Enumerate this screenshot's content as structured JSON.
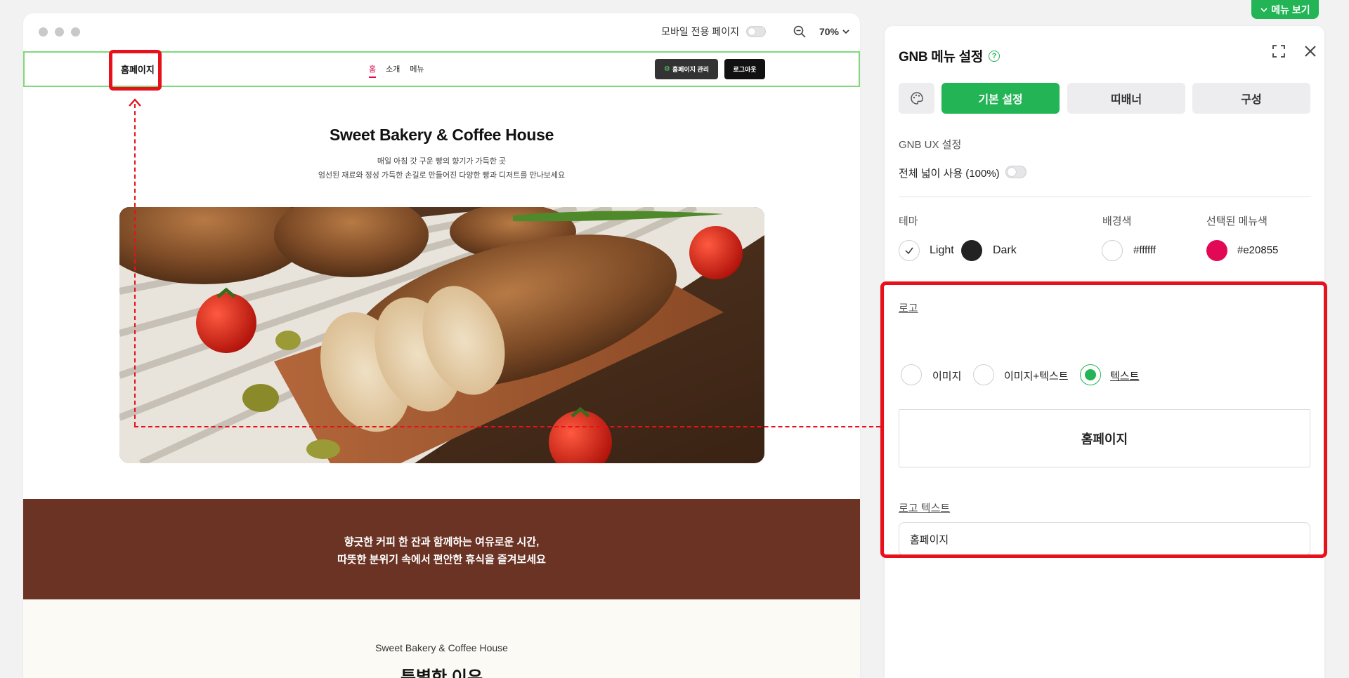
{
  "preview": {
    "mobile_label": "모바일 전용 페이지",
    "zoom": "70%",
    "gnb": {
      "logo": "홈페이지",
      "menu": [
        "홈",
        "소개",
        "메뉴"
      ],
      "manage_button": "홈페이지 관리",
      "logout_button": "로그아웃"
    },
    "hero": {
      "title": "Sweet Bakery & Coffee House",
      "sub1": "매일 아침 갓 구운 빵의 향기가 가득한 곳",
      "sub2": "엄선된 재료와 정성 가득한 손길로 만들어진 다양한 빵과 디저트를 만나보세요"
    },
    "band": {
      "line1": "향긋한 커피 한 잔과 함께하는 여유로운 시간,",
      "line2": "따뜻한 분위기 속에서 편안한 휴식을 즐겨보세요"
    },
    "section": {
      "small": "Sweet Bakery & Coffee House",
      "big": "특별한 이유"
    }
  },
  "panel": {
    "menu_view_button": "메뉴 보기",
    "title": "GNB 메뉴 설정",
    "tabs": {
      "basic": "기본 설정",
      "banner": "띠배너",
      "compose": "구성"
    },
    "gnb_ux_label": "GNB UX 설정",
    "full_width_label": "전체 넓이 사용 (100%)",
    "theme_label": "테마",
    "theme_light": "Light",
    "theme_dark": "Dark",
    "bg_label": "배경색",
    "bg_value": "#ffffff",
    "selected_menu_label": "선택된 메뉴색",
    "selected_menu_value": "#e20855",
    "logo_label": "로고",
    "logo_options": [
      "이미지",
      "이미지+텍스트",
      "텍스트"
    ],
    "logo_selected": "텍스트",
    "logo_preview": "홈페이지",
    "logo_text_label": "로고 텍스트",
    "logo_text_value": "홈페이지"
  },
  "colors": {
    "accent": "#22b455",
    "selected_menu": "#e20855",
    "band": "#6a3324",
    "annotation": "#e8101b"
  }
}
